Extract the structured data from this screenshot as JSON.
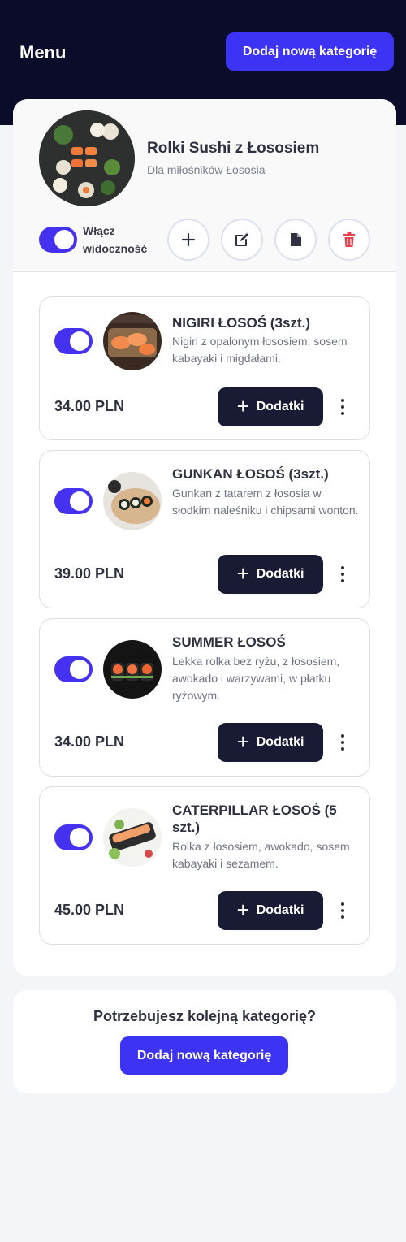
{
  "header": {
    "title": "Menu",
    "add_category_label": "Dodaj nową kategorię"
  },
  "category": {
    "title": "Rolki Sushi z Łososiem",
    "subtitle": "Dla miłośników Łososia",
    "visibility_label": "Włącz widoczność",
    "visibility_on": true,
    "action_icons": [
      "plus-icon",
      "edit-icon",
      "file-icon",
      "trash-icon"
    ]
  },
  "items": [
    {
      "title": "NIGIRI ŁOSOŚ (3szt.)",
      "description": "Nigiri z opalonym łososiem, sosem kabayaki i migdałami.",
      "price": "34.00 PLN",
      "addons_label": "Dodatki",
      "enabled": true
    },
    {
      "title": "GUNKAN ŁOSOŚ (3szt.)",
      "description": "Gunkan z tatarem z łososia w słodkim naleśniku i chipsami wonton.",
      "price": "39.00 PLN",
      "addons_label": "Dodatki",
      "enabled": true
    },
    {
      "title": "SUMMER ŁOSOŚ",
      "description": "Lekka rolka bez ryżu, z łososiem, awokado i warzywami, w płatku ryżowym.",
      "price": "34.00 PLN",
      "addons_label": "Dodatki",
      "enabled": true
    },
    {
      "title": "CATERPILLAR ŁOSOŚ (5 szt.)",
      "description": "Rolka z łososiem, awokado, sosem kabayaki i sezamem.",
      "price": "45.00 PLN",
      "addons_label": "Dodatki",
      "enabled": true
    }
  ],
  "footer": {
    "question": "Potrzebujesz kolejną kategorię?",
    "add_category_label": "Dodaj nową kategorię"
  },
  "colors": {
    "accent": "#3d33f5",
    "header_bg": "#0b0b2a",
    "dark_button": "#181b33",
    "delete": "#e5424f"
  }
}
